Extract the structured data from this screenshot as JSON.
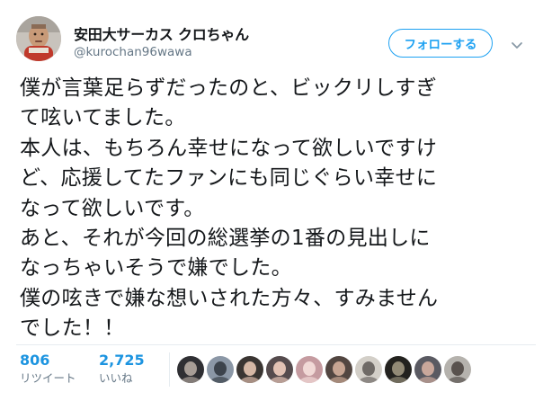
{
  "header": {
    "display_name": "安田大サーカス クロちゃん",
    "handle": "@kurochan96wawa",
    "follow_label": "フォローする"
  },
  "tweet": {
    "lines": [
      "僕が言葉足らずだったのと、ビックリしすぎ",
      "て呟いてました。",
      "本人は、もちろん幸せになって欲しいですけ",
      "ど、応援してたファンにも同じぐらい幸せに",
      "なって欲しいです。",
      "あと、それが今回の総選挙の1番の見出しに",
      "なっちゃいそうで嫌でした。",
      "僕の呟きで嫌な想いされた方々、すみません",
      "でした！！"
    ]
  },
  "stats": {
    "retweets": {
      "count": "806",
      "label": "リツイート"
    },
    "likes": {
      "count": "2,725",
      "label": "いいね"
    }
  },
  "liker_avatars": [
    {
      "name": "liker-avatar-1",
      "bg": "#2f2f33",
      "fg": "#a79d96"
    },
    {
      "name": "liker-avatar-2",
      "bg": "#8b97a6",
      "fg": "#3c434c"
    },
    {
      "name": "liker-avatar-3",
      "bg": "#3a3532",
      "fg": "#d5b7a5"
    },
    {
      "name": "liker-avatar-4",
      "bg": "#554b4d",
      "fg": "#e2c2b4"
    },
    {
      "name": "liker-avatar-5",
      "bg": "#c59ba0",
      "fg": "#f1d9d6"
    },
    {
      "name": "liker-avatar-6",
      "bg": "#524641",
      "fg": "#c7a593"
    },
    {
      "name": "liker-avatar-7",
      "bg": "#d3cfc8",
      "fg": "#6f6a66"
    },
    {
      "name": "liker-avatar-8",
      "bg": "#23221f",
      "fg": "#928a76"
    },
    {
      "name": "liker-avatar-9",
      "bg": "#5a5a62",
      "fg": "#c9a79b"
    },
    {
      "name": "liker-avatar-10",
      "bg": "#b5b2ad",
      "fg": "#59524e"
    }
  ],
  "colors": {
    "accent": "#1da1f2",
    "stat_count": "#1c94e0",
    "secondary_text": "#657786",
    "primary_text": "#14171a",
    "divider": "#e6ecf0"
  },
  "icons": {
    "caret": "chevron-down-icon"
  }
}
